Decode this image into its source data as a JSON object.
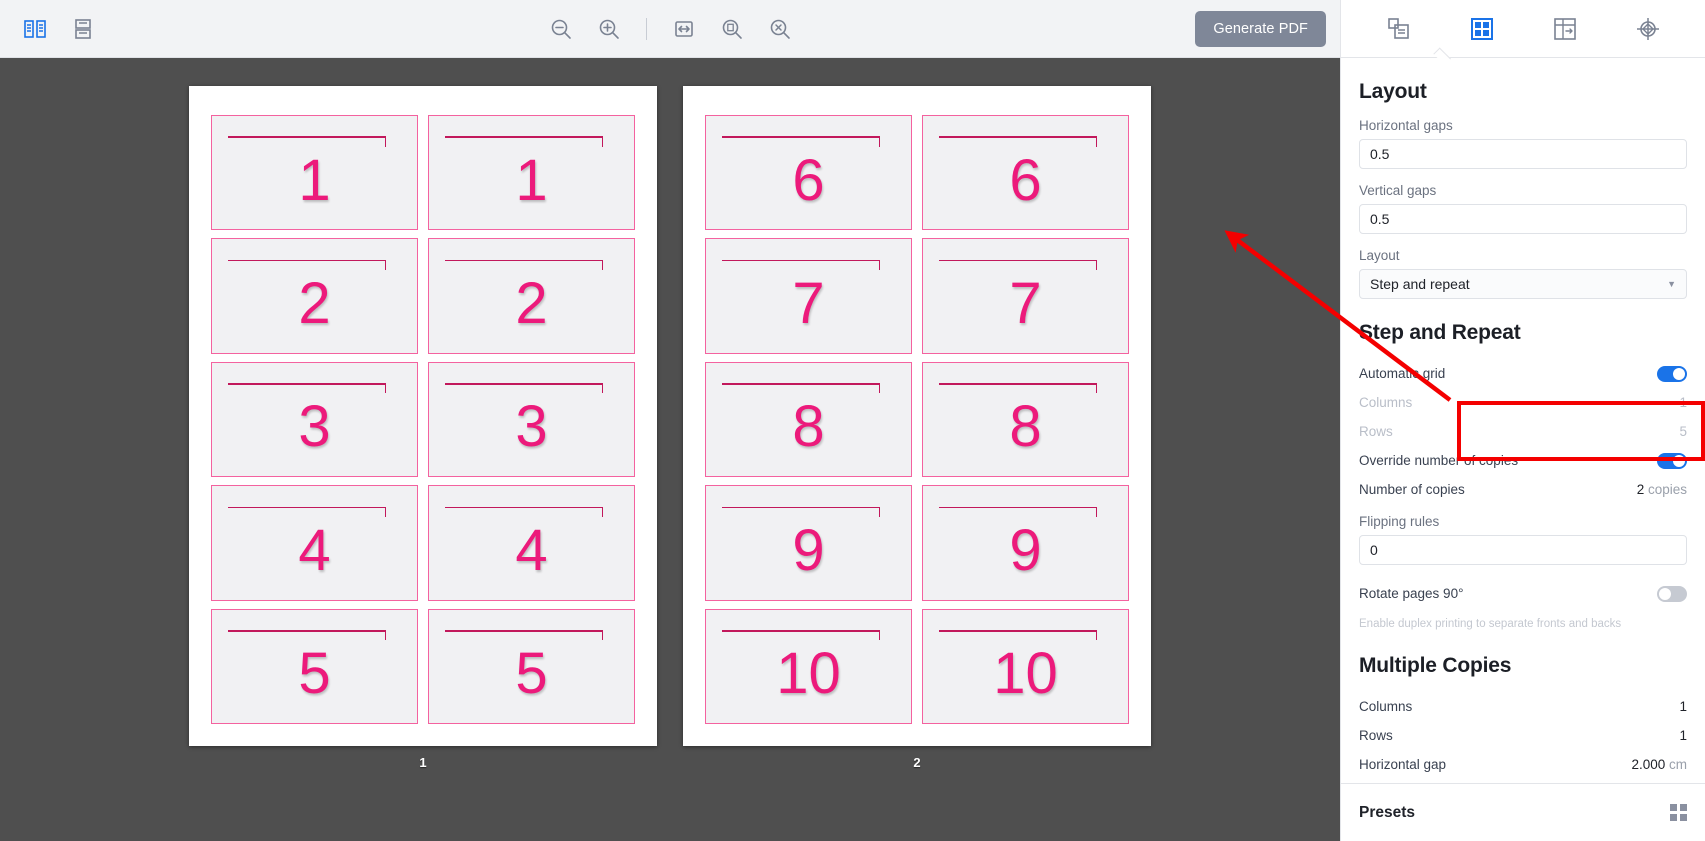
{
  "toolbar": {
    "view_side_by_side_icon": "two-page-view-icon",
    "view_stacked_icon": "stacked-page-view-icon",
    "zoom_out_icon": "zoom-out-icon",
    "zoom_in_icon": "zoom-in-icon",
    "fit_width_icon": "fit-width-icon",
    "actual_size_icon": "actual-size-icon",
    "fit_page_icon": "fit-page-icon",
    "generate_label": "Generate PDF"
  },
  "canvas": {
    "pages": [
      {
        "label": "1",
        "cards": [
          "1",
          "1",
          "2",
          "2",
          "3",
          "3",
          "4",
          "4",
          "5",
          "5"
        ]
      },
      {
        "label": "2",
        "cards": [
          "6",
          "6",
          "7",
          "7",
          "8",
          "8",
          "9",
          "9",
          "10",
          "10"
        ]
      }
    ]
  },
  "panel": {
    "tabs": [
      {
        "name": "pages-tab",
        "icon": "copy-pages-icon",
        "active": false
      },
      {
        "name": "layout-tab",
        "icon": "grid-layout-icon",
        "active": true
      },
      {
        "name": "marks-tab",
        "icon": "bleed-marks-icon",
        "active": false
      },
      {
        "name": "registration-tab",
        "icon": "registration-target-icon",
        "active": false
      }
    ],
    "layout": {
      "title": "Layout",
      "horizontal_gaps_label": "Horizontal gaps",
      "horizontal_gaps_value": "0.5",
      "vertical_gaps_label": "Vertical gaps",
      "vertical_gaps_value": "0.5",
      "layout_label": "Layout",
      "layout_value": "Step and repeat"
    },
    "step_and_repeat": {
      "title": "Step and Repeat",
      "rows": [
        {
          "label": "Automatic grid",
          "type": "toggle",
          "on": true,
          "muted": false
        },
        {
          "label": "Columns",
          "type": "value",
          "value": "1",
          "muted": true
        },
        {
          "label": "Rows",
          "type": "value",
          "value": "5",
          "muted": true
        },
        {
          "label": "Override number of copies",
          "type": "toggle",
          "on": true,
          "muted": false
        },
        {
          "label": "Number of copies",
          "type": "value",
          "value": "2",
          "unit": "copies",
          "muted": false
        }
      ],
      "flipping_rules_label": "Flipping rules",
      "flipping_rules_value": "0",
      "rotate_label": "Rotate pages 90°",
      "rotate_on": false,
      "duplex_hint": "Enable duplex printing to separate fronts and backs"
    },
    "multiple_copies": {
      "title": "Multiple Copies",
      "rows": [
        {
          "label": "Columns",
          "value": "1",
          "unit": ""
        },
        {
          "label": "Rows",
          "value": "1",
          "unit": ""
        },
        {
          "label": "Horizontal gap",
          "value": "2.000",
          "unit": "cm"
        }
      ]
    },
    "footer": {
      "presets_label": "Presets",
      "grid_icon": "preset-grid-icon"
    }
  },
  "annotations": {
    "highlight_color": "#f40000",
    "arrow_color": "#f40000"
  }
}
